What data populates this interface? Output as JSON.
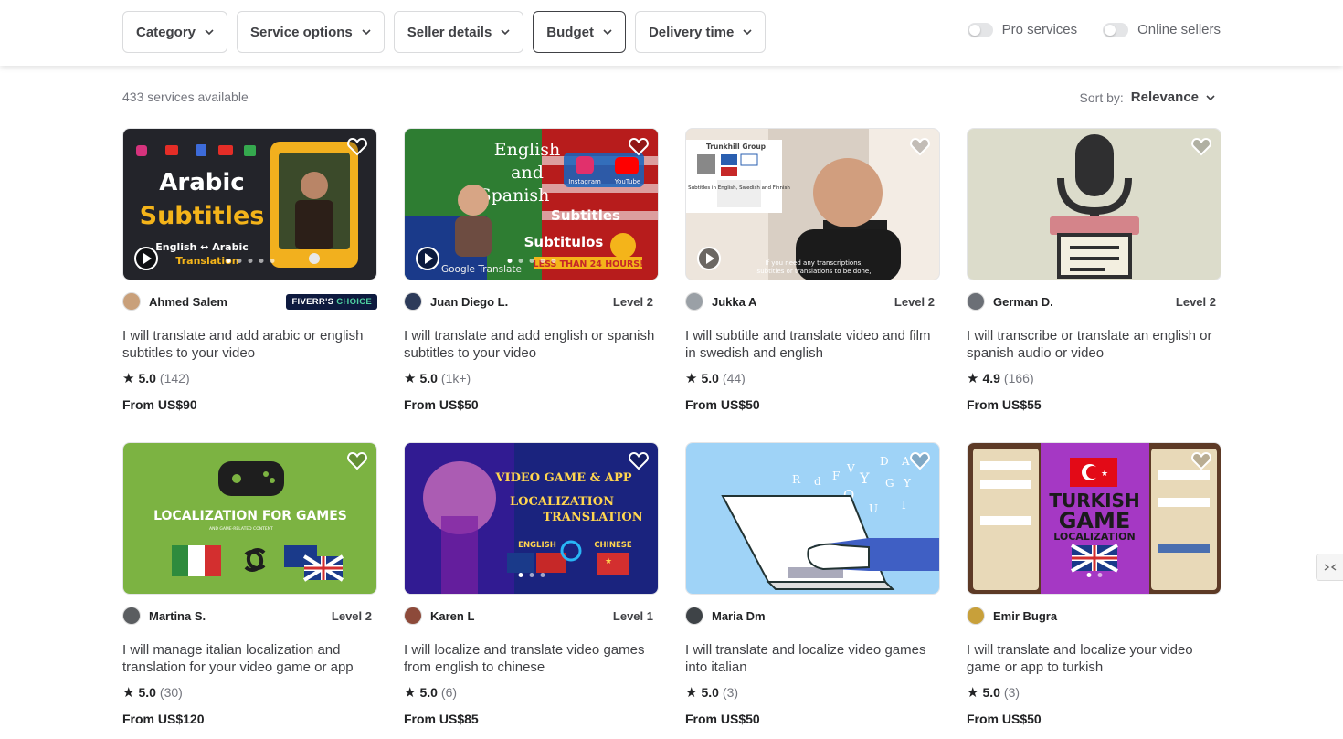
{
  "filters": [
    {
      "label": "Category"
    },
    {
      "label": "Service options"
    },
    {
      "label": "Seller details"
    },
    {
      "label": "Budget"
    },
    {
      "label": "Delivery time"
    }
  ],
  "toggles": {
    "pro": "Pro services",
    "online": "Online sellers"
  },
  "results": {
    "count": "433 services available",
    "sort_label": "Sort by:",
    "sort_value": "Relevance"
  },
  "gigs": [
    {
      "seller": "Ahmed Salem",
      "badge": "FIVERR'S",
      "badge2": "CHOICE",
      "level": "",
      "title": "I will translate and add arabic or english subtitles to your video",
      "rating": "5.0",
      "reviews": "(142)",
      "price": "From US$90",
      "art": {
        "title1": "Arabic",
        "title2": "Subtitles",
        "line3": "English ↔ Arabic",
        "line4": "Translation"
      }
    },
    {
      "seller": "Juan Diego L.",
      "badge": "",
      "level": "Level 2",
      "title": "I will translate and add english or spanish subtitles to your video",
      "rating": "5.0",
      "reviews": "(1k+)",
      "price": "From US$50",
      "art": {
        "title1": "English",
        "title2": "and",
        "title3": "Spanish",
        "tag1": "Instagram",
        "tag2": "YouTube",
        "sub1": "Subtitles",
        "sub2": "Subtitulos",
        "deadline": "LESS THAN 24 HOURS!",
        "gt": "Google Translate"
      }
    },
    {
      "seller": "Jukka A",
      "badge": "",
      "level": "Level 2",
      "title": "I will subtitle and translate video and film in swedish and english",
      "rating": "5.0",
      "reviews": "(44)",
      "price": "From US$50",
      "art": {
        "brand": "Trunkhill Group",
        "box": "Subtitles in English, Swedish and Finnish",
        "caption1": "If you need any transcriptions,",
        "caption2": "subtitles or translations to be done,"
      }
    },
    {
      "seller": "German D.",
      "badge": "",
      "level": "Level 2",
      "title": "I will transcribe or translate an english or spanish audio or video",
      "rating": "4.9",
      "reviews": "(166)",
      "price": "From US$55",
      "art": {}
    },
    {
      "seller": "Martina S.",
      "badge": "",
      "level": "Level 2",
      "title": "I will manage italian localization and translation for your video game or app",
      "rating": "5.0",
      "reviews": "(30)",
      "price": "From US$120",
      "art": {
        "title1": "LOCALIZATION FOR GAMES",
        "sub": "AND GAME-RELATED CONTENT"
      }
    },
    {
      "seller": "Karen L",
      "badge": "",
      "level": "Level 1",
      "title": "I will localize and translate video games from english to chinese",
      "rating": "5.0",
      "reviews": "(6)",
      "price": "From US$85",
      "art": {
        "t1": "VIDEO GAME & APP",
        "t2": "LOCALIZATION",
        "t3": "TRANSLATION",
        "l1": "ENGLISH",
        "l2": "CHINESE"
      }
    },
    {
      "seller": "Maria Dm",
      "badge": "",
      "level": "",
      "title": "I will translate and localize video games into italian",
      "rating": "5.0",
      "reviews": "(3)",
      "price": "From US$50",
      "art": {}
    },
    {
      "seller": "Emir Bugra",
      "badge": "",
      "level": "",
      "title": "I will translate and localize your video game or app to turkish",
      "rating": "5.0",
      "reviews": "(3)",
      "price": "From US$50",
      "art": {
        "t1": "TURKISH",
        "t2": "GAME",
        "t3": "LOCALIZATION"
      }
    }
  ]
}
